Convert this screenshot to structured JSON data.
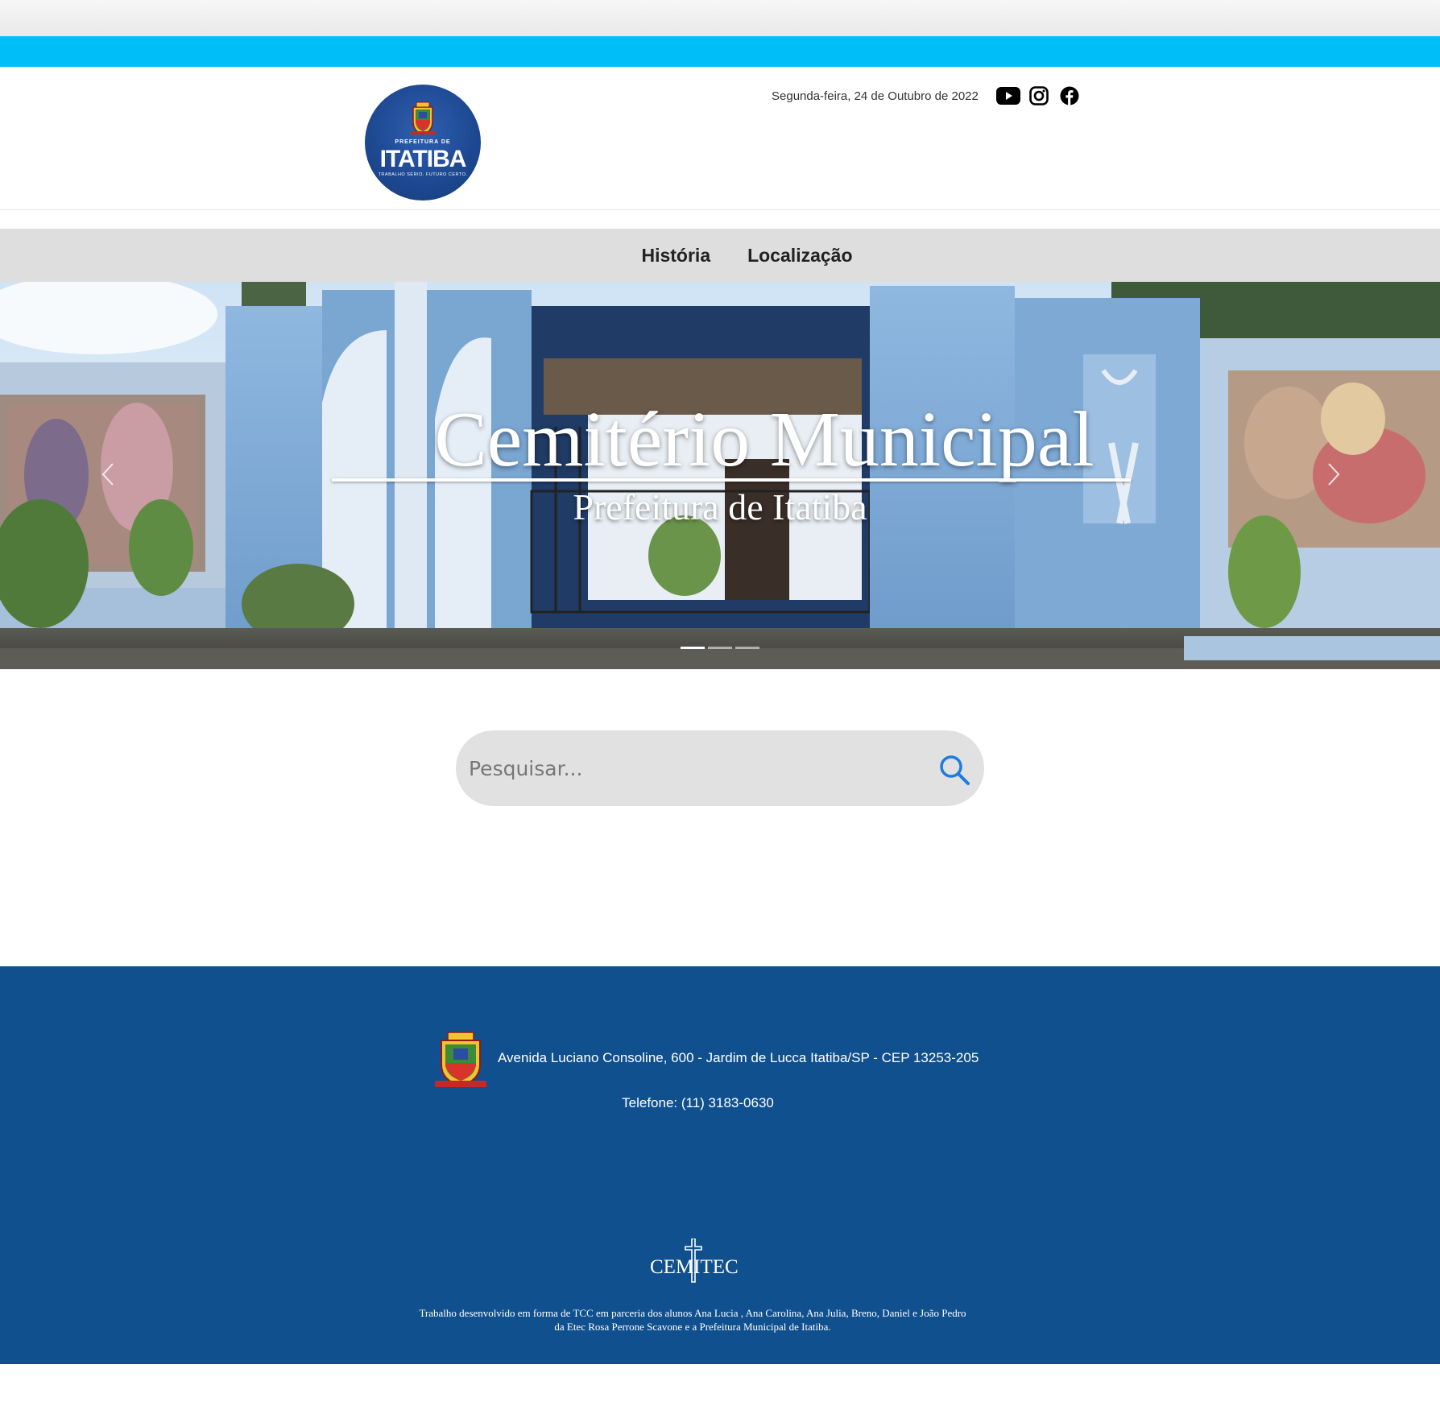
{
  "header": {
    "date": "Segunda-feira, 24 de Outubro de 2022",
    "logo": {
      "small_text": "PREFEITURA DE",
      "name": "ITATIBA",
      "tagline": "TRABALHO SÉRIO. FUTURO CERTO."
    },
    "social_icons": [
      "youtube-icon",
      "instagram-icon",
      "facebook-icon"
    ]
  },
  "nav": {
    "items": [
      {
        "label": "História"
      },
      {
        "label": "Localização"
      }
    ]
  },
  "hero": {
    "title": "Cemitério Municipal",
    "subtitle": "Prefeitura de Itatiba",
    "slides": 3,
    "active_slide": 1
  },
  "search": {
    "placeholder": "Pesquisar..."
  },
  "footer": {
    "address": "Avenida Luciano Consoline, 600 - Jardim de Lucca Itatiba/SP - CEP 13253-205",
    "phone": "Telefone: (11) 3183-0630",
    "brand": "CEMITEC",
    "credits_line1": "Trabalho desenvolvido em forma de TCC em parceria dos alunos Ana Lucia , Ana Carolina, Ana Julia, Breno, Daniel e João Pedro",
    "credits_line2": "da Etec Rosa Perrone Scavone e a Prefeitura Municipal de Itatiba."
  },
  "colors": {
    "accent": "#00bff8",
    "footer": "#10508f",
    "nav": "#dedede",
    "search_icon": "#1e7be0"
  }
}
